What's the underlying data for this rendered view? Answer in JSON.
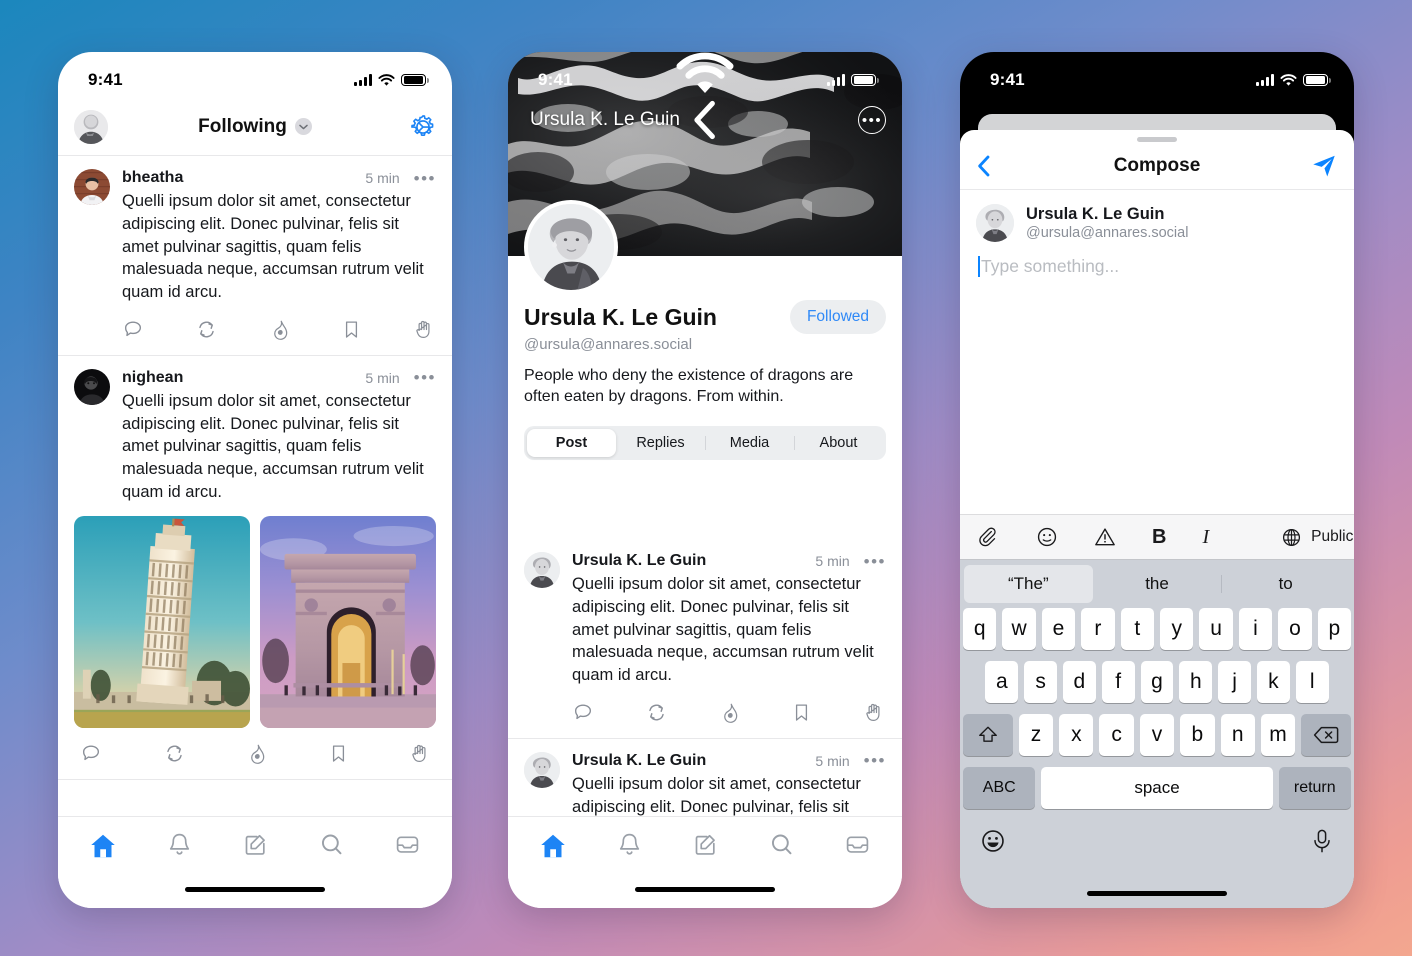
{
  "status_bar": {
    "time": "9:41"
  },
  "phone1": {
    "header": {
      "title": "Following",
      "avatar_name": "user-avatar",
      "settings_icon": "gear-icon",
      "chevron": "chevron-down-icon"
    },
    "posts": [
      {
        "name": "bheatha",
        "time": "5 min",
        "more": "•••",
        "text": "Quelli ipsum dolor sit amet, consectetur adipiscing elit. Donec pulvinar, felis sit amet pulvinar sagittis, quam felis malesuada neque, accumsan rutrum velit quam id arcu.",
        "has_media": false
      },
      {
        "name": "nighean",
        "time": "5 min",
        "more": "•••",
        "text": "Quelli ipsum dolor sit amet, consectetur adipiscing elit. Donec pulvinar, felis sit amet pulvinar sagittis, quam felis malesuada neque, accumsan rutrum velit quam id arcu.",
        "has_media": true,
        "media": [
          "leaning-tower-of-pisa-photo",
          "india-gate-arch-photo"
        ]
      }
    ],
    "post_actions": [
      "reply-icon",
      "boost-icon",
      "favourite-flame-icon",
      "bookmark-icon",
      "raised-hand-icon"
    ],
    "tabbar": [
      "home-icon",
      "notifications-bell-icon",
      "compose-icon",
      "search-icon",
      "inbox-icon"
    ],
    "active_tab": "home-icon"
  },
  "phone2": {
    "banner": {
      "image": "black-and-white-sea-foam-photo",
      "back": "back-chevron-icon",
      "title": "Ursula K. Le Guin",
      "more": "•••"
    },
    "profile": {
      "name": "Ursula K. Le Guin",
      "handle": "@ursula@annares.social",
      "follow_label": "Followed",
      "bio": "People who deny the existence of dragons are often eaten by dragons. From within."
    },
    "tabs": [
      {
        "label": "Post",
        "active": true
      },
      {
        "label": "Replies",
        "active": false
      },
      {
        "label": "Media",
        "active": false
      },
      {
        "label": "About",
        "active": false
      }
    ],
    "posts": [
      {
        "name": "Ursula K. Le Guin",
        "time": "5 min",
        "more": "•••",
        "text": "Quelli ipsum dolor sit amet, consectetur adipiscing elit. Donec pulvinar, felis sit amet pulvinar sagittis, quam felis malesuada neque, accumsan rutrum velit quam id arcu."
      },
      {
        "name": "Ursula K. Le Guin",
        "time": "5 min",
        "more": "•••",
        "text": "Quelli ipsum dolor sit amet, consectetur adipiscing elit. Donec pulvinar, felis sit amet pulvinar sagittis, quam felis malesuada neque, accumsan rutrum velit"
      }
    ],
    "post_actions": [
      "reply-icon",
      "boost-icon",
      "favourite-flame-icon",
      "bookmark-icon",
      "raised-hand-icon"
    ],
    "tabbar": [
      "home-icon",
      "notifications-bell-icon",
      "compose-icon",
      "search-icon",
      "inbox-icon"
    ],
    "active_tab": "home-icon"
  },
  "phone3": {
    "nav": {
      "back": "back-chevron-icon",
      "title": "Compose",
      "send": "send-paper-plane-icon"
    },
    "author": {
      "name": "Ursula K. Le Guin",
      "handle": "@ursula@annares.social"
    },
    "editor": {
      "placeholder": "Type something...",
      "value": ""
    },
    "toolbar": {
      "items": [
        "attachment-paperclip-icon",
        "emoji-icon",
        "content-warning-icon",
        "bold-icon",
        "italic-icon"
      ],
      "bold_label": "B",
      "italic_label": "I",
      "visibility_icon": "globe-icon",
      "visibility_label": "Public"
    },
    "keyboard": {
      "predictions": [
        {
          "label": "“The”",
          "selected": true
        },
        {
          "label": "the",
          "selected": false
        },
        {
          "label": "to",
          "selected": false
        }
      ],
      "row1": [
        "q",
        "w",
        "e",
        "r",
        "t",
        "y",
        "u",
        "i",
        "o",
        "p"
      ],
      "row2": [
        "a",
        "s",
        "d",
        "f",
        "g",
        "h",
        "j",
        "k",
        "l"
      ],
      "row3": [
        "z",
        "x",
        "c",
        "v",
        "b",
        "n",
        "m"
      ],
      "shift": "shift-icon",
      "backspace": "backspace-icon",
      "abc_label": "ABC",
      "space_label": "space",
      "return_label": "return",
      "emoji_key": "emoji-keyboard-icon",
      "mic_key": "microphone-icon"
    }
  },
  "colors": {
    "accent": "#1d84f5",
    "send_blue": "#0b84ff",
    "followed_text": "#2f89f7",
    "muted": "#8a8f98",
    "divider": "#e8e8ea",
    "keyboard_bg": "#cdd1d8"
  }
}
